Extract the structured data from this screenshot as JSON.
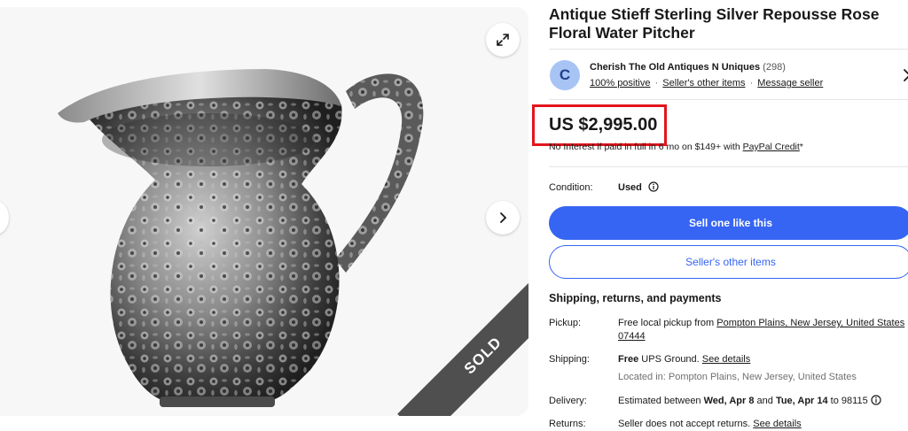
{
  "listing": {
    "title": "Antique Stieff Sterling Silver Repousse Rose Floral Water Pitcher",
    "sold_ribbon": "SOLD"
  },
  "seller": {
    "avatar_letter": "C",
    "name": "Cherish The Old Antiques N Uniques",
    "feedback_count": "(298)",
    "positive": "100% positive",
    "sep": "·",
    "other_items": "Seller's other items",
    "message": "Message seller"
  },
  "price": {
    "amount": "US $2,995.00",
    "financing_prefix": "No Interest if paid in full in 6 mo on $149+ with ",
    "financing_link": "PayPal Credit",
    "financing_suffix": "*"
  },
  "condition": {
    "label": "Condition:",
    "value": "Used"
  },
  "buttons": {
    "sell_one": "Sell one like this",
    "sellers_items": "Seller's other items"
  },
  "shipping": {
    "heading": "Shipping, returns, and payments",
    "pickup_label": "Pickup:",
    "pickup_text": "Free local pickup from ",
    "pickup_link": "Pompton Plains, New Jersey, United States 07444",
    "shipping_label": "Shipping:",
    "shipping_bold": "Free",
    "shipping_text": " UPS Ground. ",
    "shipping_link": "See details",
    "located": "Located in: Pompton Plains, New Jersey, United States",
    "delivery_label": "Delivery:",
    "delivery_prefix": "Estimated between ",
    "delivery_start": "Wed, Apr 8",
    "delivery_and": " and ",
    "delivery_end": "Tue, Apr 14",
    "delivery_suffix": " to 98115",
    "returns_label": "Returns:",
    "returns_text": "Seller does not accept returns. ",
    "returns_link": "See details"
  },
  "colors": {
    "accent_blue": "#3665f3",
    "highlight_red": "#e4141c",
    "ribbon_gray": "#4f4f4f"
  },
  "icons": [
    "expand-icon",
    "chevron-right-icon",
    "info-icon",
    "chevron-right-icon"
  ]
}
